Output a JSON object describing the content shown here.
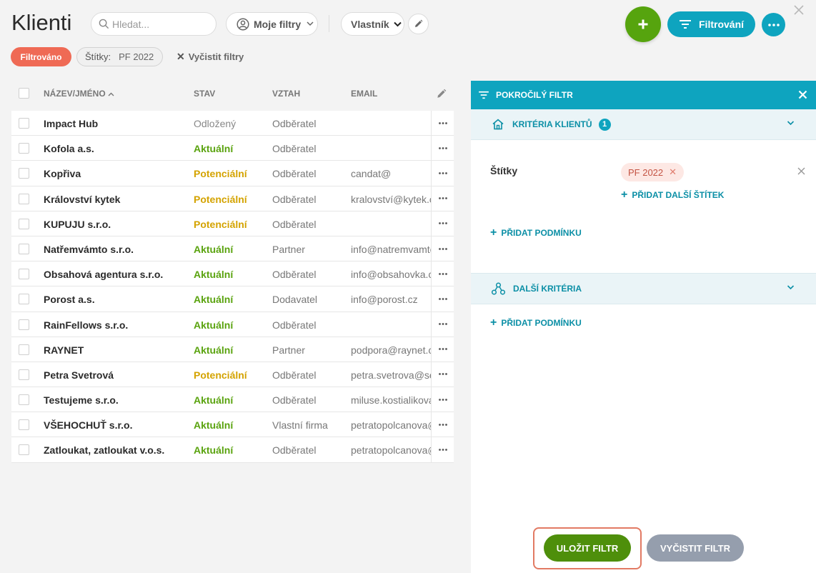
{
  "header": {
    "title": "Klienti",
    "search_placeholder": "Hledat...",
    "my_filters_label": "Moje filtry",
    "owner_label": "Vlastník",
    "filter_button_label": "Filtrování"
  },
  "filter_bar": {
    "filtered_badge": "Filtrováno",
    "tag_chip_key": "Štítky:",
    "tag_chip_value": "PF 2022",
    "clear_filters": "Vyčistit filtry"
  },
  "table": {
    "columns": [
      "NÁZEV/JMÉNO",
      "STAV",
      "VZTAH",
      "EMAIL"
    ],
    "rows": [
      {
        "name": "Impact Hub",
        "status": "Odložený",
        "status_kind": "odlozeny",
        "relation": "Odběratel",
        "email": ""
      },
      {
        "name": "Kofola a.s.",
        "status": "Aktuální",
        "status_kind": "aktualni",
        "relation": "Odběratel",
        "email": ""
      },
      {
        "name": "Kopřiva",
        "status": "Potenciální",
        "status_kind": "potencialni",
        "relation": "Odběratel",
        "email": "candat@"
      },
      {
        "name": "Království kytek",
        "status": "Potenciální",
        "status_kind": "potencialni",
        "relation": "Odběratel",
        "email": "kralovství@kytek.cz"
      },
      {
        "name": "KUPUJU s.r.o.",
        "status": "Potenciální",
        "status_kind": "potencialni",
        "relation": "Odběratel",
        "email": ""
      },
      {
        "name": "Natřemvámto s.r.o.",
        "status": "Aktuální",
        "status_kind": "aktualni",
        "relation": "Partner",
        "email": "info@natremvamto.cz"
      },
      {
        "name": "Obsahová agentura s.r.o.",
        "status": "Aktuální",
        "status_kind": "aktualni",
        "relation": "Odběratel",
        "email": "info@obsahovka.cz"
      },
      {
        "name": "Porost a.s.",
        "status": "Aktuální",
        "status_kind": "aktualni",
        "relation": "Dodavatel",
        "email": "info@porost.cz"
      },
      {
        "name": "RainFellows s.r.o.",
        "status": "Aktuální",
        "status_kind": "aktualni",
        "relation": "Odběratel",
        "email": ""
      },
      {
        "name": "RAYNET",
        "status": "Aktuální",
        "status_kind": "aktualni",
        "relation": "Partner",
        "email": "podpora@raynet.cz"
      },
      {
        "name": "Petra Svetrová",
        "status": "Potenciální",
        "status_kind": "potencialni",
        "relation": "Odběratel",
        "email": "petra.svetrova@seznam.cz"
      },
      {
        "name": "Testujeme s.r.o.",
        "status": "Aktuální",
        "status_kind": "aktualni",
        "relation": "Odběratel",
        "email": "miluse.kostialikova@"
      },
      {
        "name": "VŠEHOCHUŤ s.r.o.",
        "status": "Aktuální",
        "status_kind": "aktualni",
        "relation": "Vlastní firma",
        "email": "petratopolcanova@"
      },
      {
        "name": "Zatloukat, zatloukat v.o.s.",
        "status": "Aktuální",
        "status_kind": "aktualni",
        "relation": "Odběratel",
        "email": "petratopolcanova@"
      }
    ]
  },
  "panel": {
    "title": "POKROČILÝ FILTR",
    "section1_title": "KRITÉRIA KLIENTŮ",
    "section1_count": "1",
    "criterion_label": "Štítky",
    "criterion_tag": "PF 2022",
    "add_tag": "PŘIDAT DALŠÍ ŠTÍTEK",
    "add_condition": "PŘIDAT PODMÍNKU",
    "section2_title": "DALŠÍ KRITÉRIA",
    "add_condition2": "PŘIDAT PODMÍNKU",
    "save_button": "ULOŽIT FILTR",
    "clear_button": "VYČISTIT FILTR"
  },
  "colors": {
    "accent": "#0ea4bf",
    "add_green": "#56a40e",
    "filtered_badge": "#ef6a55",
    "status_aktualni": "#5aa30f",
    "status_potencialni": "#d4a300"
  },
  "icons": [
    "search-icon",
    "user-circle-icon",
    "chevron-down-icon",
    "pencil-icon",
    "plus-icon",
    "filter-icon",
    "more-icon",
    "close-icon",
    "home-icon",
    "network-icon"
  ]
}
